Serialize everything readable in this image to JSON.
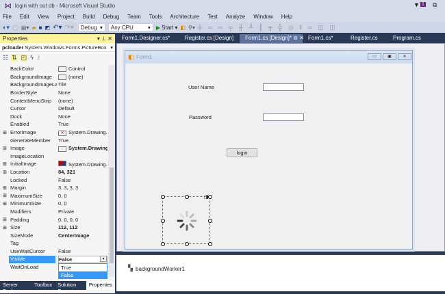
{
  "window": {
    "title": "login with out db - Microsoft Visual Studio",
    "notification_count": "1"
  },
  "menu": [
    "File",
    "Edit",
    "View",
    "Project",
    "Build",
    "Debug",
    "Team",
    "Tools",
    "Architecture",
    "Test",
    "Analyze",
    "Window",
    "Help"
  ],
  "toolbar": {
    "config": "Debug",
    "platform": "Any CPU",
    "start": "Start"
  },
  "properties": {
    "title": "Properties",
    "object": "pcloader",
    "object_type": "System.Windows.Forms.PictureBox",
    "rows": [
      {
        "name": "BackColor",
        "value": "Control",
        "exp": false,
        "bold": false
      },
      {
        "name": "BackgroundImage",
        "value": "(none)",
        "exp": false,
        "bold": false
      },
      {
        "name": "BackgroundImageLayout",
        "value": "Tile",
        "exp": false,
        "bold": false
      },
      {
        "name": "BorderStyle",
        "value": "None",
        "exp": false,
        "bold": false
      },
      {
        "name": "ContextMenuStrip",
        "value": "(none)",
        "exp": false,
        "bold": false
      },
      {
        "name": "Cursor",
        "value": "Default",
        "exp": false,
        "bold": false
      },
      {
        "name": "Dock",
        "value": "None",
        "exp": false,
        "bold": false
      },
      {
        "name": "Enabled",
        "value": "True",
        "exp": false,
        "bold": false
      },
      {
        "name": "ErrorImage",
        "value": "System.Drawing.Bitmap",
        "exp": true,
        "bold": false
      },
      {
        "name": "GenerateMember",
        "value": "True",
        "exp": false,
        "bold": false
      },
      {
        "name": "Image",
        "value": "System.Drawing",
        "exp": true,
        "bold": true
      },
      {
        "name": "ImageLocation",
        "value": "",
        "exp": false,
        "bold": false
      },
      {
        "name": "InitialImage",
        "value": "System.Drawing.Bitmap",
        "exp": true,
        "bold": false
      },
      {
        "name": "Location",
        "value": "84, 321",
        "exp": true,
        "bold": true
      },
      {
        "name": "Locked",
        "value": "False",
        "exp": false,
        "bold": false
      },
      {
        "name": "Margin",
        "value": "3, 3, 3, 3",
        "exp": true,
        "bold": false
      },
      {
        "name": "MaximumSize",
        "value": "0, 0",
        "exp": true,
        "bold": false
      },
      {
        "name": "MinimumSize",
        "value": "0, 0",
        "exp": true,
        "bold": false
      },
      {
        "name": "Modifiers",
        "value": "Private",
        "exp": false,
        "bold": false
      },
      {
        "name": "Padding",
        "value": "0, 0, 0, 0",
        "exp": true,
        "bold": false
      },
      {
        "name": "Size",
        "value": "112, 112",
        "exp": true,
        "bold": true
      },
      {
        "name": "SizeMode",
        "value": "CenterImage",
        "exp": false,
        "bold": true
      },
      {
        "name": "Tag",
        "value": "",
        "exp": false,
        "bold": false
      },
      {
        "name": "UseWaitCursor",
        "value": "False",
        "exp": false,
        "bold": false
      },
      {
        "name": "Visible",
        "value": "False",
        "exp": false,
        "bold": true
      },
      {
        "name": "WaitOnLoad",
        "value": "",
        "exp": false,
        "bold": false
      }
    ],
    "dropdown_options": [
      "True",
      "False"
    ]
  },
  "bottom_tabs": [
    "Server Expl...",
    "Toolbox",
    "Solution Ex...",
    "Properties"
  ],
  "doc_tabs": [
    "Form1.Designer.cs*",
    "Register.cs [Design]",
    "Form1.cs [Design]*",
    "Form1.cs*",
    "Register.cs",
    "Program.cs"
  ],
  "form": {
    "title": "Form1",
    "username_label": "User Name",
    "password_label": "Password",
    "login_button": "login"
  },
  "tray": {
    "component": "backgroundWorker1"
  }
}
